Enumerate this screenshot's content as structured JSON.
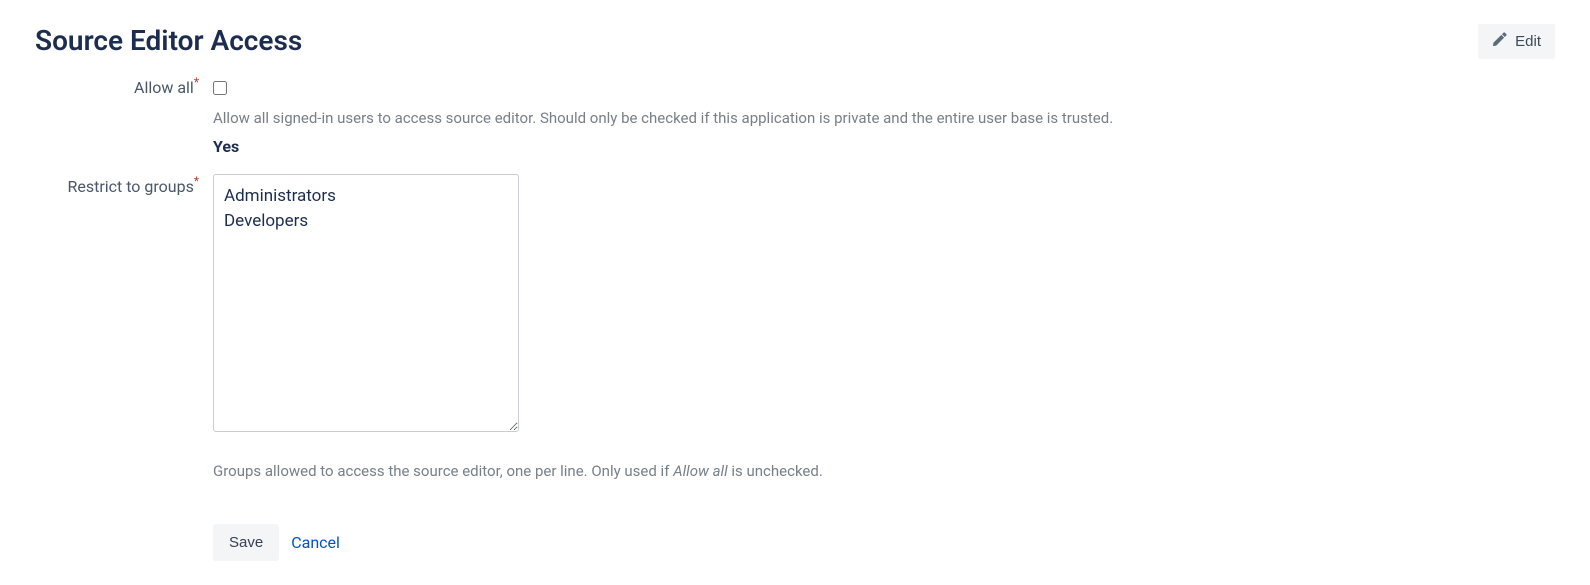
{
  "header": {
    "title": "Source Editor Access",
    "edit_label": "Edit"
  },
  "allow_all": {
    "label": "Allow all",
    "required_mark": "*",
    "checked": false,
    "help": "Allow all signed-in users to access source editor. Should only be checked if this application is private and the entire user base is trusted.",
    "value_display": "Yes"
  },
  "restrict_groups": {
    "label": "Restrict to groups",
    "required_mark": "*",
    "value": "Administrators\nDevelopers",
    "help_prefix": "Groups allowed to access the source editor, one per line. Only used if ",
    "help_em": "Allow all",
    "help_suffix": " is unchecked."
  },
  "actions": {
    "save_label": "Save",
    "cancel_label": "Cancel"
  }
}
